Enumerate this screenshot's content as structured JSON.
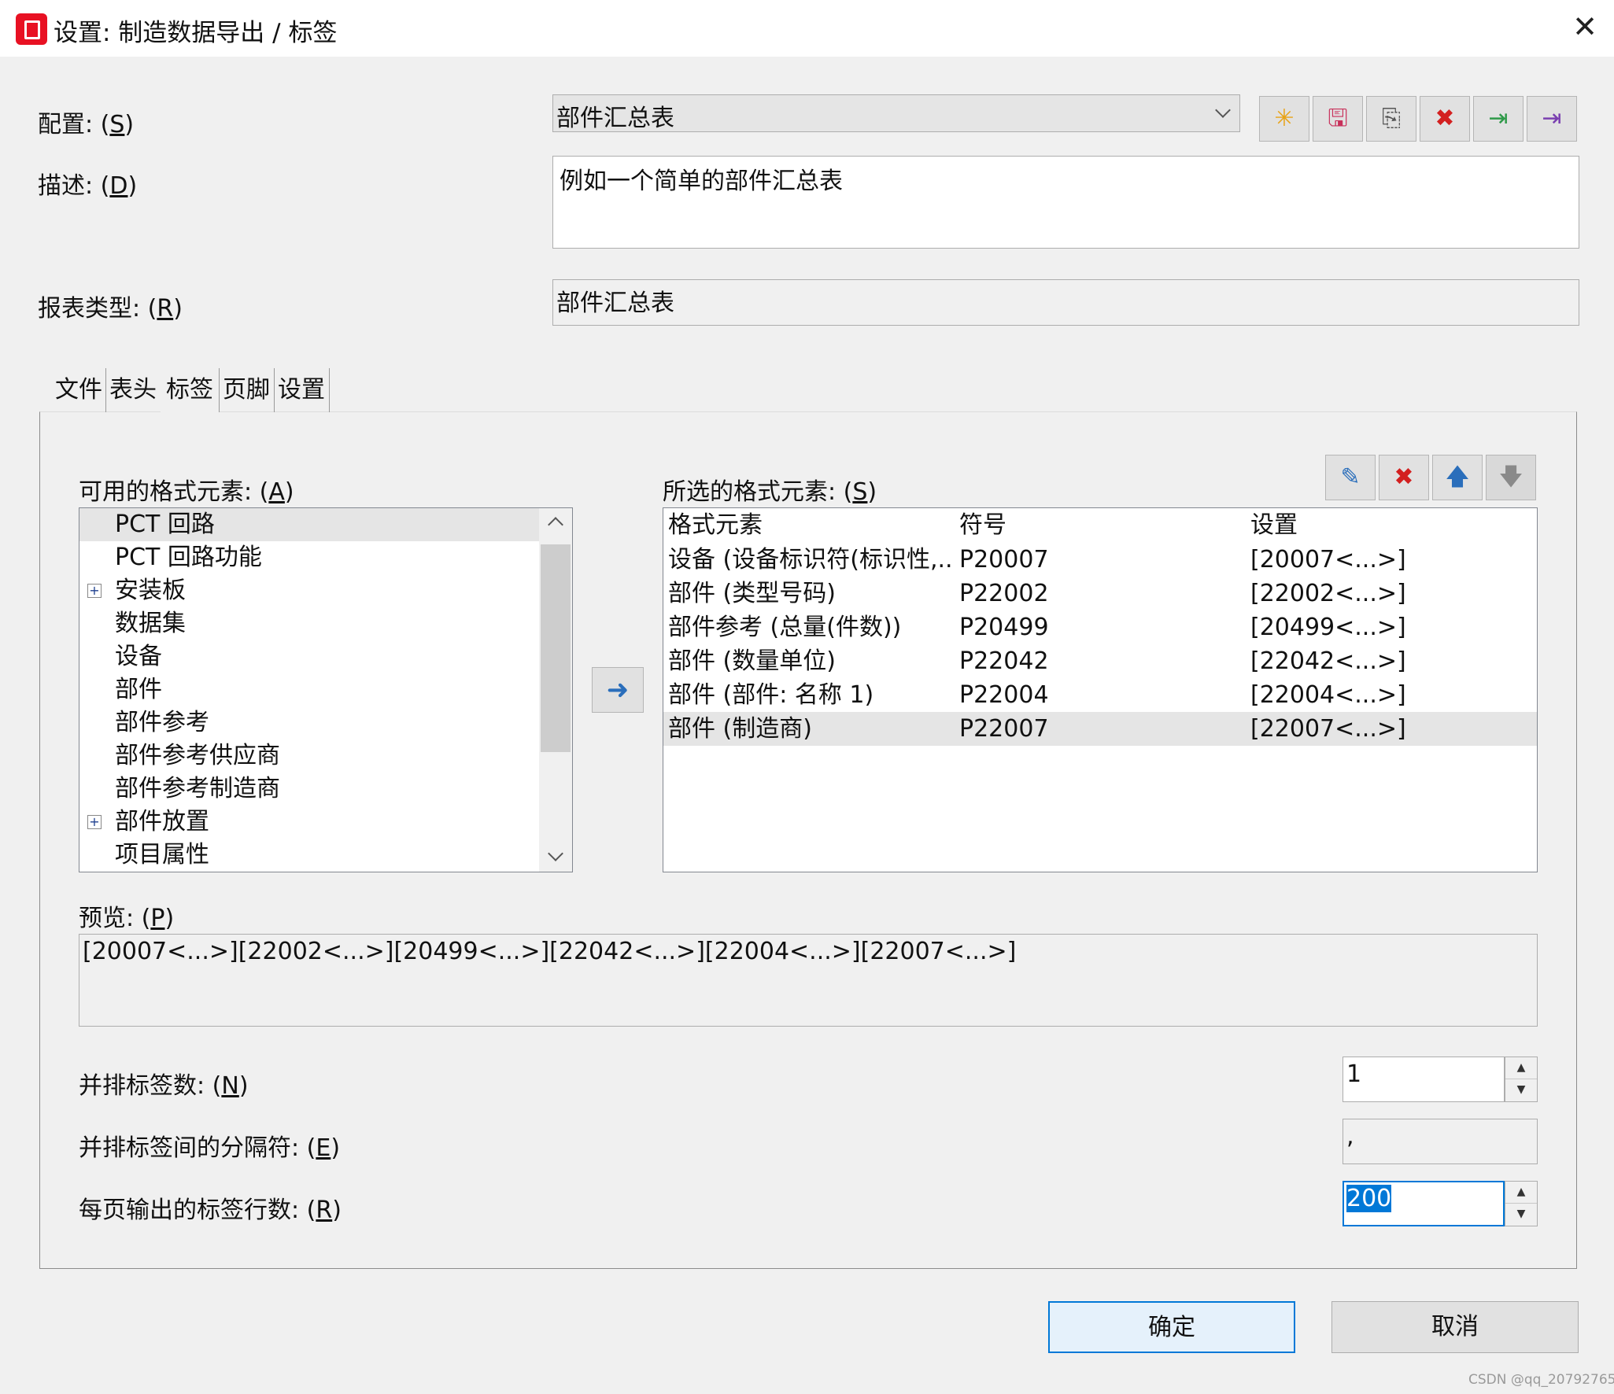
{
  "window": {
    "title": "设置: 制造数据导出 / 标签",
    "close_glyph": "✕"
  },
  "form": {
    "config_label": "配置: (",
    "config_key": "S",
    "config_value": "部件汇总表",
    "desc_label": "描述: (",
    "desc_key": "D",
    "desc_value": "例如一个简单的部件汇总表",
    "report_type_label": "报表类型: (",
    "report_type_key": "R",
    "report_type_value": "部件汇总表",
    "close_paren": ")"
  },
  "toolbar": [
    {
      "icon": "new-icon",
      "glyph": "✳",
      "color": "#e8a317"
    },
    {
      "icon": "save-icon",
      "glyph": "🖫",
      "color": "#c8305a"
    },
    {
      "icon": "copy-icon",
      "glyph": "⎘",
      "color": "#555555"
    },
    {
      "icon": "delete-icon",
      "glyph": "✖",
      "color": "#d32020"
    },
    {
      "icon": "import-icon",
      "glyph": "⇥",
      "color": "#2f9a4a"
    },
    {
      "icon": "export-icon",
      "glyph": "⇥",
      "color": "#7a3fb0"
    }
  ],
  "tabs": [
    {
      "label": "文件",
      "active": false
    },
    {
      "label": "表头",
      "active": false
    },
    {
      "label": "标签",
      "active": true
    },
    {
      "label": "页脚",
      "active": false
    },
    {
      "label": "设置",
      "active": false
    }
  ],
  "available": {
    "label": "可用的格式元素: (",
    "key": "A",
    "items": [
      {
        "label": "PCT 回路",
        "expandable": false,
        "selected": true
      },
      {
        "label": "PCT 回路功能",
        "expandable": false,
        "selected": false
      },
      {
        "label": "安装板",
        "expandable": true,
        "selected": false
      },
      {
        "label": "数据集",
        "expandable": false,
        "selected": false
      },
      {
        "label": "设备",
        "expandable": false,
        "selected": false
      },
      {
        "label": "部件",
        "expandable": false,
        "selected": false
      },
      {
        "label": "部件参考",
        "expandable": false,
        "selected": false
      },
      {
        "label": "部件参考供应商",
        "expandable": false,
        "selected": false
      },
      {
        "label": "部件参考制造商",
        "expandable": false,
        "selected": false
      },
      {
        "label": "部件放置",
        "expandable": true,
        "selected": false
      },
      {
        "label": "项目属性",
        "expandable": false,
        "selected": false
      }
    ]
  },
  "selected_elements": {
    "label": "所选的格式元素: (",
    "key": "S",
    "columns": [
      "格式元素",
      "符号",
      "设置"
    ],
    "rows": [
      {
        "element": "设备 (设备标识符(标识性,...",
        "symbol": "P20007",
        "setting": "[20007<...>]",
        "selected": false
      },
      {
        "element": "部件 (类型号码)",
        "symbol": "P22002",
        "setting": "[22002<...>]",
        "selected": false
      },
      {
        "element": "部件参考 (总量(件数))",
        "symbol": "P20499",
        "setting": "[20499<...>]",
        "selected": false
      },
      {
        "element": "部件 (数量单位)",
        "symbol": "P22042",
        "setting": "[22042<...>]",
        "selected": false
      },
      {
        "element": "部件 (部件: 名称 1)",
        "symbol": "P22004",
        "setting": "[22004<...>]",
        "selected": false
      },
      {
        "element": "部件 (制造商)",
        "symbol": "P22007",
        "setting": "[22007<...>]",
        "selected": true
      }
    ]
  },
  "list_toolbar": [
    {
      "icon": "edit-icon",
      "glyph": "✎",
      "color": "#2a6ebb",
      "enabled": true
    },
    {
      "icon": "remove-icon",
      "glyph": "✖",
      "color": "#d32020",
      "enabled": true
    },
    {
      "icon": "move-up-icon",
      "glyph": "🡅",
      "color": "#2a6ebb",
      "enabled": true
    },
    {
      "icon": "move-down-icon",
      "glyph": "🡇",
      "color": "#8a8a8a",
      "enabled": false
    }
  ],
  "add_button_glyph": "➜",
  "preview": {
    "label": "预览: (",
    "key": "P",
    "value": "[20007<...>][22002<...>][20499<...>][22042<...>][22004<...>][22007<...>]"
  },
  "side_by_side": {
    "label": "并排标签数: (",
    "key": "N",
    "value": "1"
  },
  "separator": {
    "label": "并排标签间的分隔符: (",
    "key": "E",
    "value": ","
  },
  "rows_per_page": {
    "label": "每页输出的标签行数: (",
    "key": "R",
    "value": "200"
  },
  "buttons": {
    "ok": "确定",
    "cancel": "取消"
  },
  "watermark": "CSDN @qq_20792765"
}
